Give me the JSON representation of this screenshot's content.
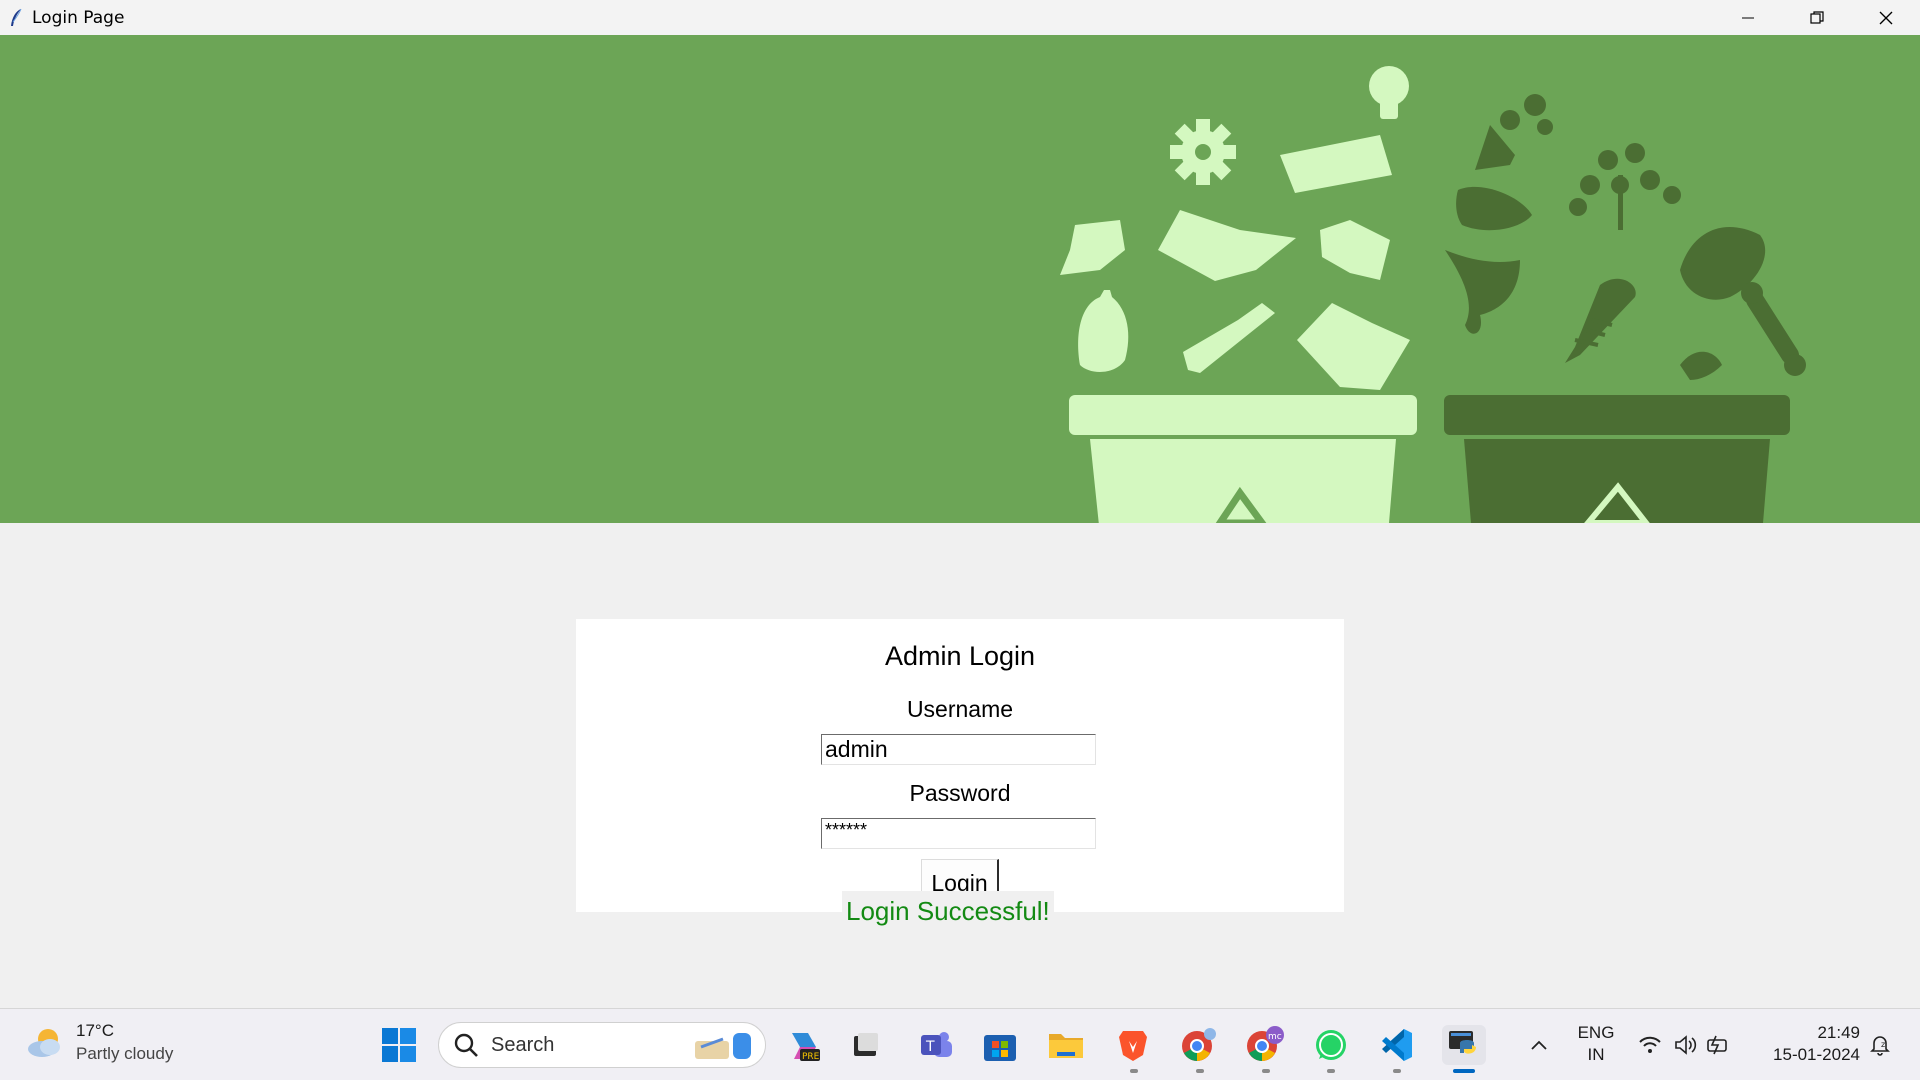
{
  "window": {
    "title": "Login Page"
  },
  "login": {
    "heading": "Admin Login",
    "username_label": "Username",
    "username_value": "admin",
    "password_label": "Password",
    "password_value": "******",
    "login_button": "Login",
    "status_message": "Login Successful!"
  },
  "colors": {
    "banner_bg": "#6ca556",
    "light_green": "#d4f8c0",
    "dark_green": "#4b6e33",
    "status_green": "#138a13"
  },
  "taskbar": {
    "weather_temp": "17°C",
    "weather_condition": "Partly cloudy",
    "search_placeholder": "Search",
    "apps": [
      "start-icon",
      "search-icon",
      "copilot-icon",
      "task-view-icon",
      "teams-icon",
      "store-icon",
      "file-explorer-icon",
      "brave-icon",
      "chrome-icon",
      "chrome-profile-icon",
      "whatsapp-icon",
      "vscode-icon",
      "python-icon"
    ],
    "language_line1": "ENG",
    "language_line2": "IN",
    "time": "21:49",
    "date": "15-01-2024"
  }
}
